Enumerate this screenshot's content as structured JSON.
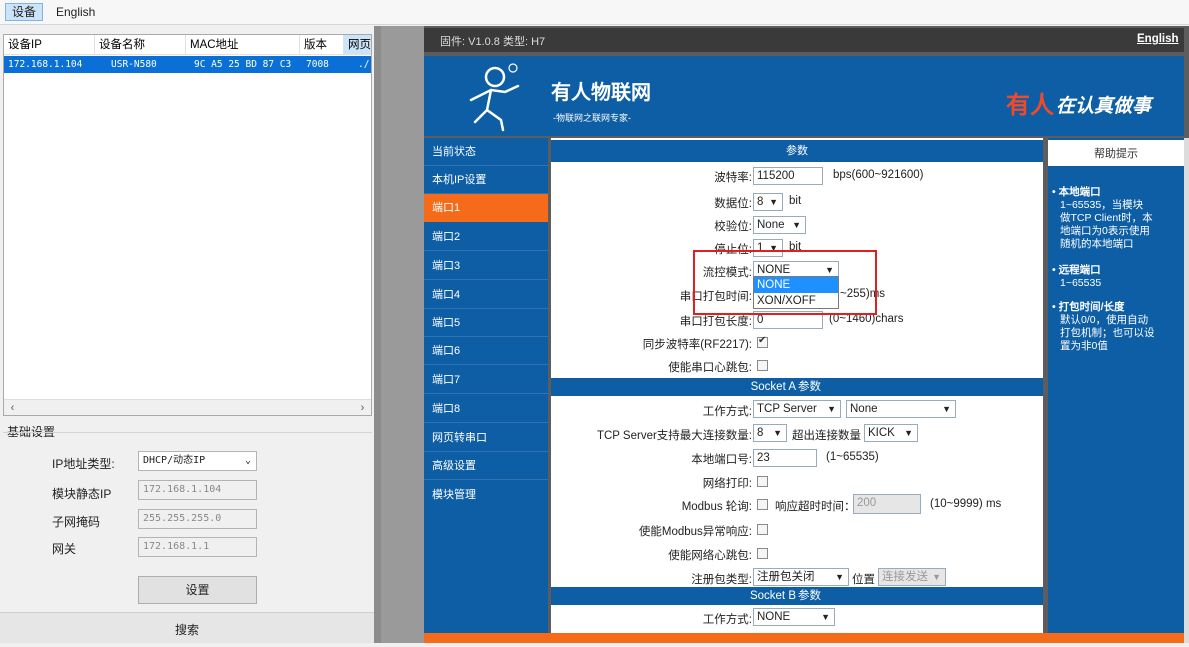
{
  "topbar": {
    "device": "设备",
    "english": "English"
  },
  "device_table": {
    "headers": [
      "设备IP",
      "设备名称",
      "MAC地址",
      "版本",
      "网页"
    ],
    "rows": [
      {
        "ip": "172.168.1.104",
        "name": "USR-N580",
        "mac": "9C A5 25 BD 87 C3",
        "version": "7008",
        "web": "./"
      }
    ]
  },
  "basic_settings": {
    "title": "基础设置",
    "ip_type_label": "IP地址类型:",
    "ip_type_value": "DHCP/动态IP",
    "static_ip_label": "模块静态IP",
    "static_ip_value": "172.168.1.104",
    "subnet_label": "子网掩码",
    "subnet_value": "255.255.255.0",
    "gateway_label": "网关",
    "gateway_value": "172.168.1.1",
    "set_button": "设置",
    "search_button": "搜索"
  },
  "web": {
    "firmware": "固件: V1.0.8 类型: H7",
    "english_link": "English",
    "brand": "有人物联网",
    "brand_sub": "-物联网之联网专家-",
    "slogan_red": "有人",
    "slogan_white": "在认真做事",
    "nav": [
      "当前状态",
      "本机IP设置",
      "端口1",
      "端口2",
      "端口3",
      "端口4",
      "端口5",
      "端口6",
      "端口7",
      "端口8",
      "网页转串口",
      "高级设置",
      "模块管理"
    ],
    "nav_active_index": 2,
    "params_title": "参数",
    "baud_label": "波特率:",
    "baud_value": "115200",
    "baud_range": "bps(600~921600)",
    "databits_label": "数据位:",
    "databits_value": "8",
    "databits_unit": "bit",
    "parity_label": "校验位:",
    "parity_value": "None",
    "stopbits_label": "停止位:",
    "stopbits_value": "1",
    "stopbits_unit": "bit",
    "flow_label": "流控模式:",
    "flow_value": "NONE",
    "flow_options": [
      "NONE",
      "XON/XOFF"
    ],
    "pack_time_label": "串口打包时间:",
    "pack_time_tail": "~255)ms",
    "pack_len_label": "串口打包长度:",
    "pack_len_value": "0",
    "pack_len_tail": "(0~1460)chars",
    "sync_baud_label": "同步波特率(RF2217):",
    "serial_heartbeat_label": "使能串口心跳包:",
    "socket_a": "Socket A",
    "socket_a_param": "参数",
    "work_mode_label": "工作方式:",
    "work_mode_value": "TCP Server",
    "work_mode_second": "None",
    "tcp_max_label": "TCP Server支持最大连接数量:",
    "tcp_max_value": "8",
    "over_label": "超出连接数量",
    "over_value": "KICK",
    "local_port_label": "本地端口号:",
    "local_port_value": "23",
    "local_port_range": "(1~65535)",
    "net_print_label": "网络打印:",
    "modbus_label": "Modbus 轮询:",
    "timeout_label": "响应超时时间：",
    "timeout_value": "200",
    "timeout_range": "(10~9999) ms",
    "modbus_err_label": "使能Modbus异常响应:",
    "net_heartbeat_label": "使能网络心跳包:",
    "reg_type_label": "注册包类型:",
    "reg_type_value": "注册包关闭",
    "reg_pos_label": "位置",
    "reg_pos_value": "连接发送",
    "socket_b": "Socket B",
    "socket_b_param": "参数",
    "work_mode_b_label": "工作方式:",
    "work_mode_b_value": "NONE",
    "help_title": "帮助提示",
    "help": [
      {
        "title": "本地端口",
        "lines": [
          "1~65535，当模块",
          "做TCP Client时，本",
          "地端口为0表示使用",
          "随机的本地端口"
        ]
      },
      {
        "title": "远程端口",
        "lines": [
          "1~65535"
        ]
      },
      {
        "title": "打包时间/长度",
        "lines": [
          "默认0/0，使用自动",
          "打包机制；也可以设",
          "置为非0值"
        ]
      }
    ]
  }
}
